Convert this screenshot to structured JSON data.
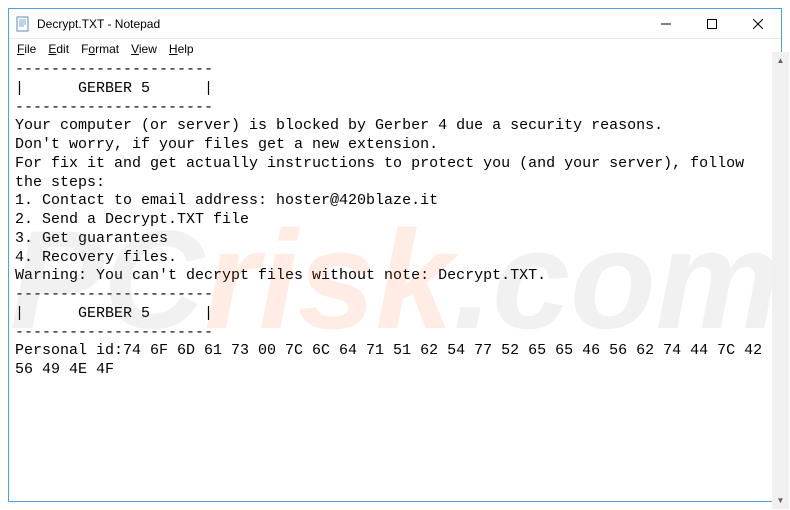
{
  "window": {
    "title": "Decrypt.TXT - Notepad",
    "controls": {
      "minimize": "—",
      "maximize": "☐",
      "close": "✕"
    }
  },
  "menubar": {
    "file": "File",
    "edit": "Edit",
    "format": "Format",
    "view": "View",
    "help": "Help"
  },
  "document": {
    "content": "----------------------\n|      GERBER 5      |\n----------------------\nYour computer (or server) is blocked by Gerber 4 due a security reasons.\nDon't worry, if your files get a new extension.\nFor fix it and get actually instructions to protect you (and your server), follow the steps:\n1. Contact to email address: hoster@420blaze.it\n2. Send a Decrypt.TXT file\n3. Get guarantees\n4. Recovery files.\nWarning: You can't decrypt files without note: Decrypt.TXT.\n----------------------\n|      GERBER 5      |\n----------------------\nPersonal id:74 6F 6D 61 73 00 7C 6C 64 71 51 62 54 77 52 65 65 46 56 62 74 44 7C 42 56 49 4E 4F"
  },
  "watermark": {
    "pc": "PC",
    "risk": "risk",
    "com": ".com"
  },
  "scrollbar": {
    "up": "▲",
    "down": "▼"
  }
}
